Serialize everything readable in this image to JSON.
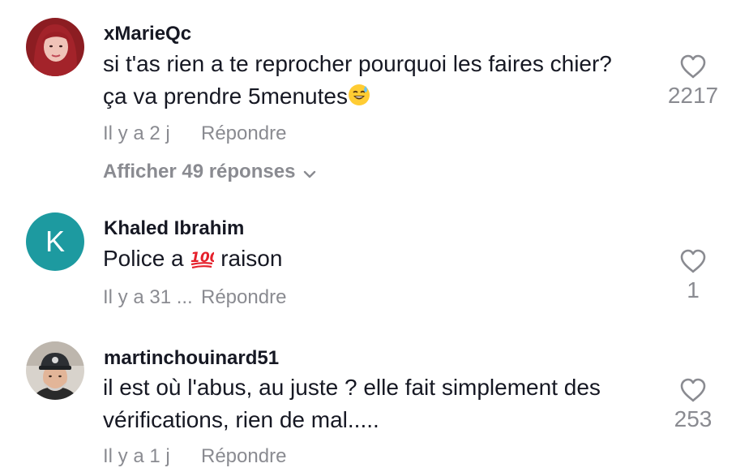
{
  "comments": [
    {
      "username": "xMarieQc",
      "avatar": "photo",
      "text_line1": "si t'as rien a te reprocher pourquoi les faires chier?",
      "text_line2": "ça va prendre 5menutes",
      "emoji": "sweat-smile-emoji",
      "time": "Il y a 2 j",
      "reply_label": "Répondre",
      "likes": "2217",
      "view_replies": "Afficher 49 réponses"
    },
    {
      "username": "Khaled Ibrahim",
      "avatar_letter": "K",
      "text_before": "Police a",
      "emoji": "hundred-points-emoji",
      "text_after": "raison",
      "time": "Il y a 31 ...",
      "reply_label": "Répondre",
      "likes": "1"
    },
    {
      "username": "martinchouinard51",
      "avatar": "photo",
      "text_line1": "il est où l'abus, au juste ? elle fait simplement des",
      "text_line2": "vérifications, rien de mal.....",
      "time": "Il y a 1 j",
      "reply_label": "Répondre",
      "likes": "253"
    }
  ],
  "colors": {
    "text": "#161823",
    "muted": "#8a8b91",
    "avatar_k": "#1d9aa0"
  }
}
